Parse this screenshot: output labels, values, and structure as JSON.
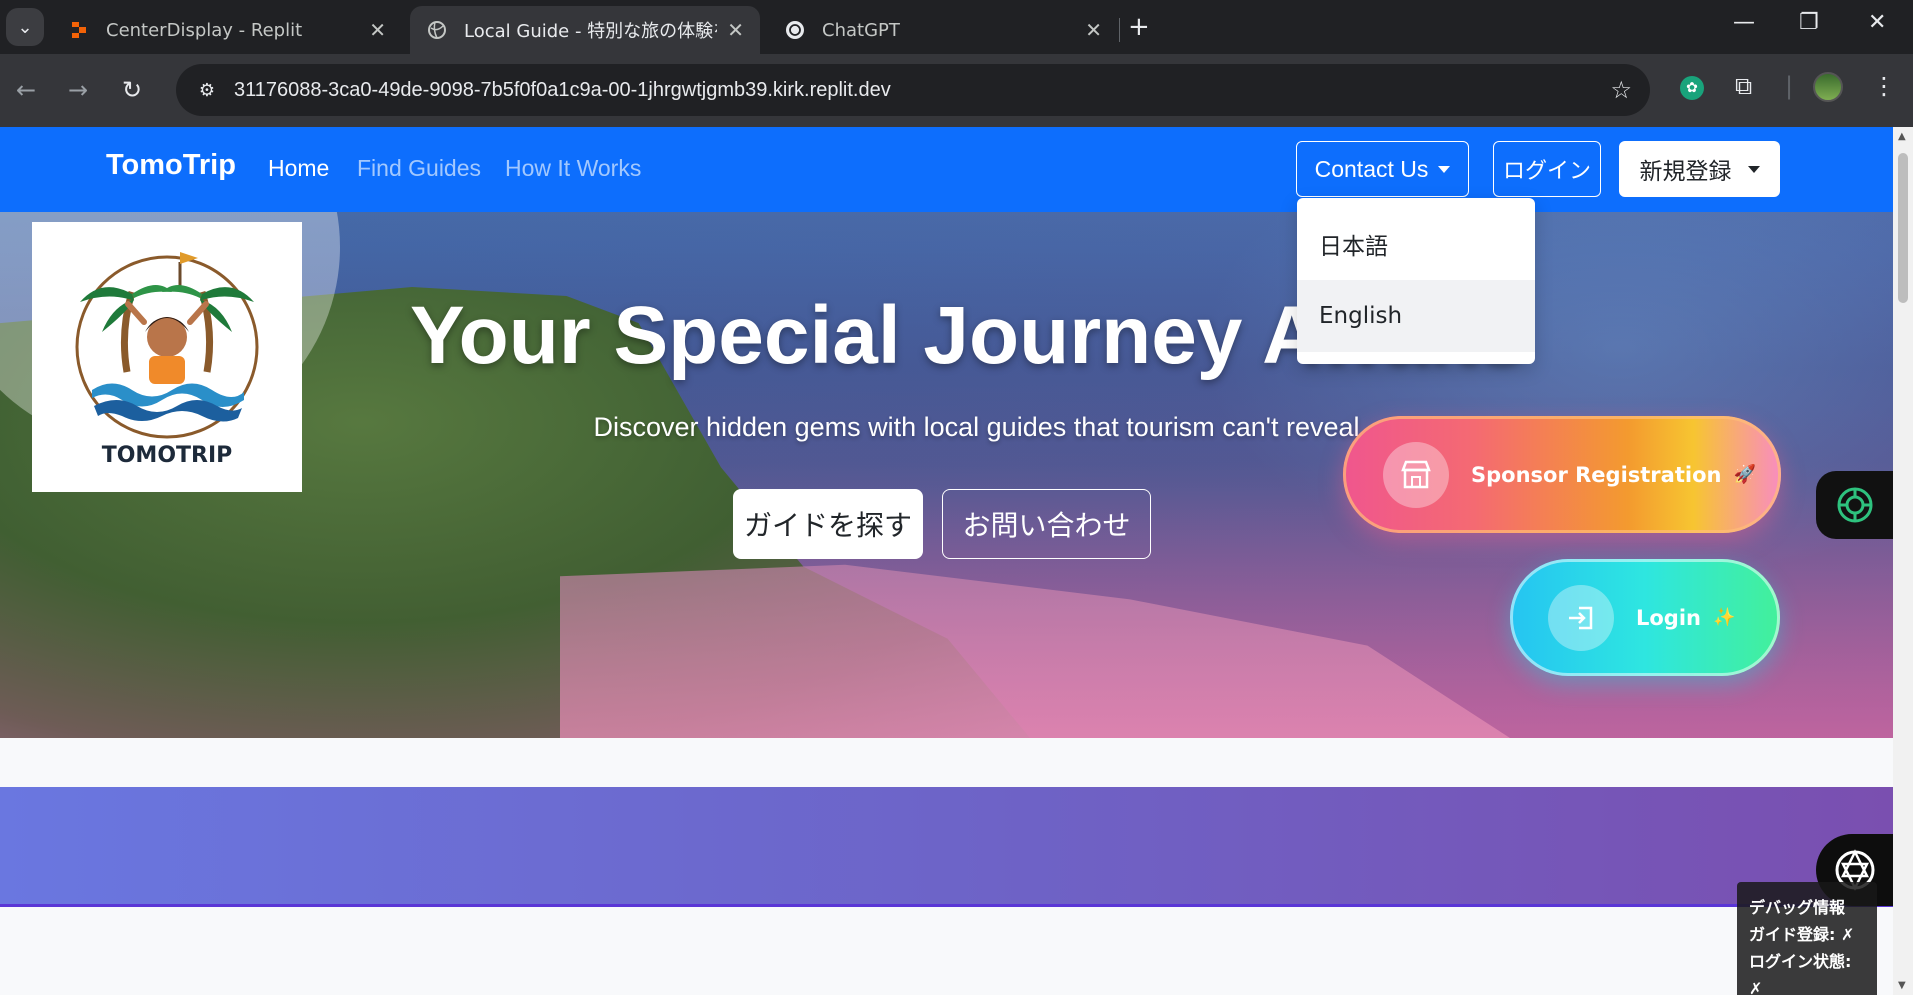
{
  "browser": {
    "tabs": [
      {
        "title": "CenterDisplay - Replit",
        "favicon": "replit-icon"
      },
      {
        "title": "Local Guide - 特別な旅の体験を",
        "favicon": "globe-icon"
      },
      {
        "title": "ChatGPT",
        "favicon": "openai-icon"
      }
    ],
    "url": "31176088-3ca0-49de-9098-7b5f0f0a1c9a-00-1jhrgwtjgmb39.kirk.replit.dev"
  },
  "navbar": {
    "brand": "TomoTrip",
    "links": [
      "Home",
      "Find Guides",
      "How It Works"
    ],
    "contact_label": "Contact Us",
    "login_label": "ログイン",
    "register_label": "新規登録",
    "color": "#0d6efd"
  },
  "language_dropdown": {
    "items": [
      "日本語",
      "English"
    ],
    "hovered": "English"
  },
  "logo": {
    "text": "TOMOTRIP"
  },
  "hero": {
    "title": "Your Special Journey Awaits",
    "subtitle": "Discover hidden gems with local guides that tourism can't reveal",
    "find_guide_label": "ガイドを探す",
    "inquiry_label": "お問い合わせ"
  },
  "floating": {
    "sponsor_label": "Sponsor Registration",
    "sponsor_emoji": "🚀",
    "login_label": "Login",
    "login_emoji": "✨"
  },
  "debug": {
    "title": "デバッグ情報",
    "guide_line": "ガイド登録: ✗",
    "login_line": "ログイン状態: ✗"
  }
}
